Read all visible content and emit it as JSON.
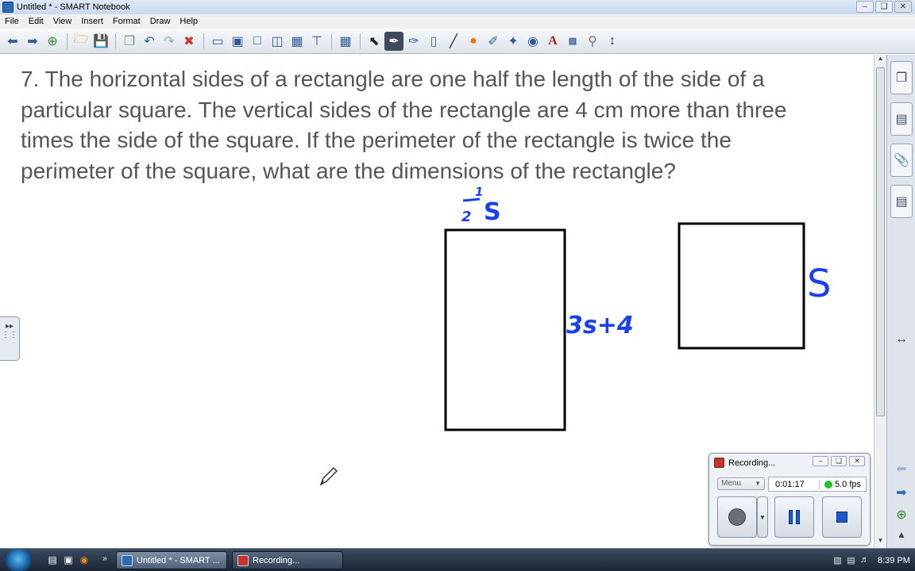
{
  "window": {
    "title": "Untitled * - SMART Notebook"
  },
  "menu": [
    "File",
    "Edit",
    "View",
    "Insert",
    "Format",
    "Draw",
    "Help"
  ],
  "toolbar": {
    "icons": [
      "back-arrow-icon",
      "forward-arrow-icon",
      "add-page-icon",
      "open-folder-icon",
      "save-icon",
      "paste-icon",
      "undo-icon",
      "redo-icon",
      "delete-icon",
      "screen-shade-icon",
      "full-screen-icon",
      "transparent-background-icon",
      "dual-page-icon",
      "capture-icon",
      "document-camera-icon",
      "table-icon",
      "select-icon",
      "pen-icon",
      "creative-pen-icon",
      "eraser-icon",
      "line-icon",
      "shape-icon",
      "shape-recognition-pen-icon",
      "magic-pen-icon",
      "fill-icon",
      "text-icon",
      "properties-icon",
      "move-toolbar-icon"
    ]
  },
  "page": {
    "question": "7.  The horizontal sides of a rectangle are one half the length of the side of a particular square.  The vertical sides of the rectangle are 4 cm more than three times the side of the square.  If the perimeter of the rectangle is twice the perimeter of the square, what are the dimensions of the rectangle?",
    "ink_color": "#1a3ff0"
  },
  "annotations": {
    "half_num": "1",
    "half_den": "2",
    "half_var": "S",
    "vertical_label": "3s+4",
    "square_label": "S"
  },
  "recorder": {
    "title": "Recording...",
    "menu_label": "Menu",
    "time": "0:01:17",
    "fps": "5.0 fps"
  },
  "taskbar": {
    "buttons": [
      "Untitled * - SMART ...",
      "Recording..."
    ],
    "clock": "8:39 PM"
  }
}
